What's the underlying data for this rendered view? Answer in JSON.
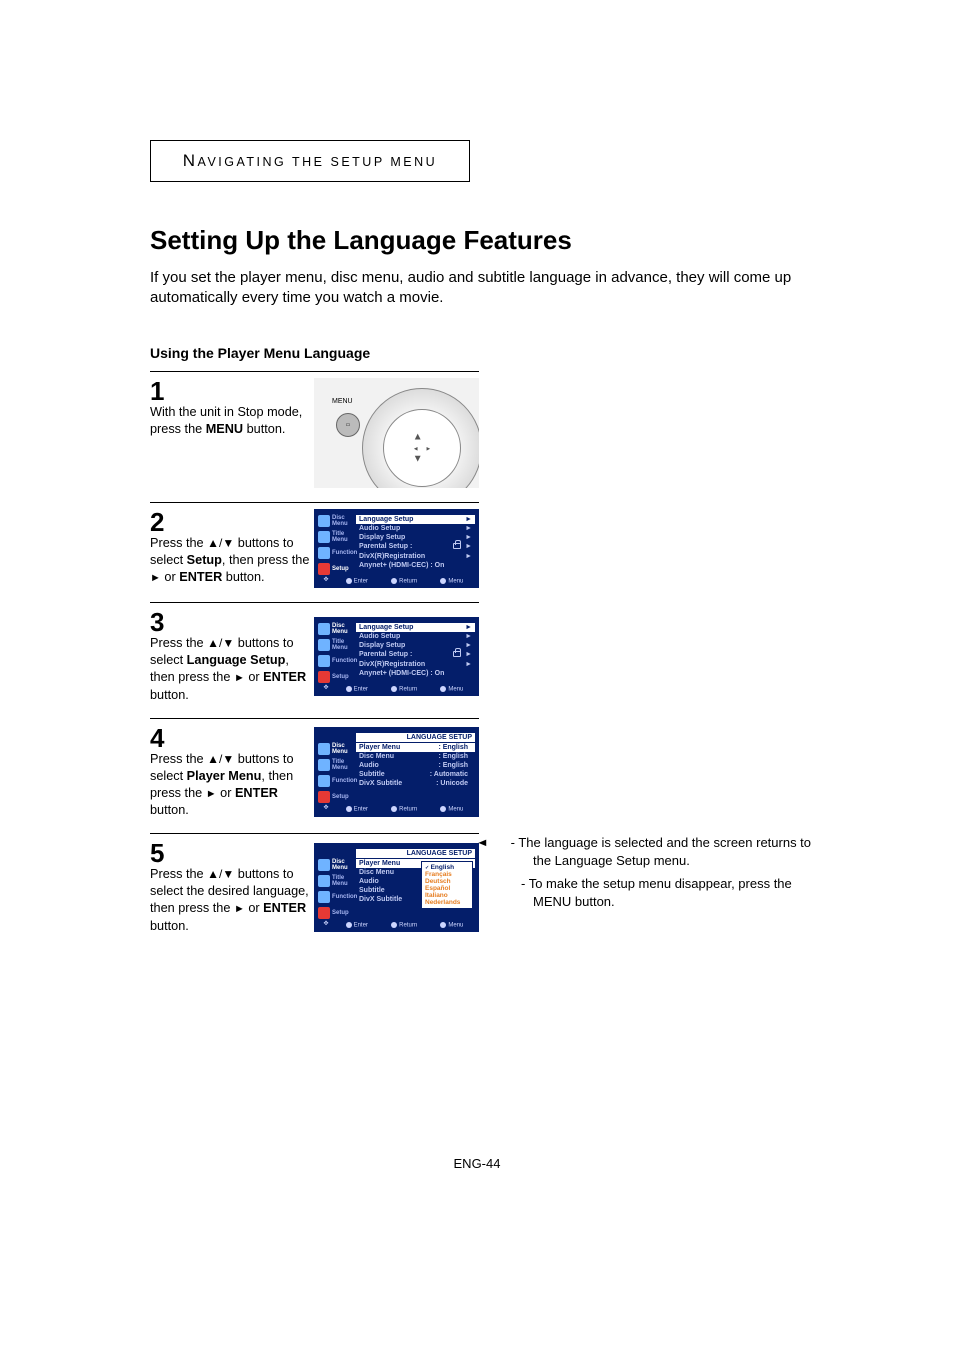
{
  "section_tab": "Navigating the setup menu",
  "heading": "Setting Up the Language Features",
  "intro": "If you set the player menu, disc menu, audio and subtitle language in advance, they will come up automatically every time you watch a movie.",
  "subheading": "Using the Player Menu Language",
  "remote": {
    "menu_label": "MENU"
  },
  "steps": {
    "s1": {
      "num": "1",
      "pre": "With the unit in Stop mode, press the ",
      "bold": "MENU",
      "post": " button."
    },
    "s2": {
      "num": "2",
      "pre": "Press the ",
      "mid": " buttons to select ",
      "bold1": "Setup",
      "mid2": ", then press the ",
      "mid3": " or ",
      "bold2": "ENTER",
      "post": " button."
    },
    "s3": {
      "num": "3",
      "pre": "Press the ",
      "mid": " buttons to select ",
      "bold1": "Language Setup",
      "mid2": ", then press the ",
      "mid3": " or ",
      "bold2": "ENTER",
      "post": " button."
    },
    "s4": {
      "num": "4",
      "pre": "Press the ",
      "mid": " buttons to select ",
      "bold1": "Player Menu",
      "mid2": ", then press the ",
      "mid3": " or ",
      "bold2": "ENTER",
      "post": " button."
    },
    "s5": {
      "num": "5",
      "pre": "Press the ",
      "mid": " buttons to select the desired language, then press the ",
      "mid3": " or ",
      "bold2": "ENTER",
      "post": " button."
    }
  },
  "notes": {
    "n1_prefix": "- ",
    "n1": "The language is selected and the screen returns to the Language Setup menu.",
    "n2_prefix": "- ",
    "n2": "To make the setup menu disappear, press the MENU button."
  },
  "osd": {
    "side": {
      "disc": "Disc Menu",
      "title": "Title Menu",
      "func": "Function",
      "setup": "Setup"
    },
    "footer": {
      "enter": "Enter",
      "ret": "Return",
      "menu": "Menu"
    },
    "screen2": {
      "rows": {
        "lang": {
          "l": "Language Setup",
          "arr": "►"
        },
        "audio": {
          "l": "Audio Setup",
          "arr": "►"
        },
        "disp": {
          "l": "Display Setup",
          "arr": "►"
        },
        "par": {
          "l": "Parental Setup :",
          "arr": "►"
        },
        "divx": {
          "l": "DivX(R)Registration",
          "arr": "►"
        },
        "any": {
          "l": "Anynet+ (HDMI-CEC) : On"
        }
      }
    },
    "screen4": {
      "title": "LANGUAGE SETUP",
      "rows": {
        "pm": {
          "l": "Player Menu",
          "v": ": English"
        },
        "dm": {
          "l": "Disc Menu",
          "v": ": English"
        },
        "au": {
          "l": "Audio",
          "v": ": English"
        },
        "st": {
          "l": "Subtitle",
          "v": ": Automatic"
        },
        "dx": {
          "l": "DivX Subtitle",
          "v": ": Unicode"
        }
      }
    },
    "screen5": {
      "title": "LANGUAGE SETUP",
      "rows": {
        "pm": {
          "l": "Player Menu"
        },
        "dm": {
          "l": "Disc Menu"
        },
        "au": {
          "l": "Audio"
        },
        "st": {
          "l": "Subtitle"
        },
        "dx": {
          "l": "DivX Subtitle"
        }
      },
      "dropdown": {
        "sel": "English",
        "o1": "Français",
        "o2": "Deutsch",
        "o3": "Español",
        "o4": "Italiano",
        "o5": "Nederlands"
      }
    }
  },
  "page_num": "ENG-44"
}
